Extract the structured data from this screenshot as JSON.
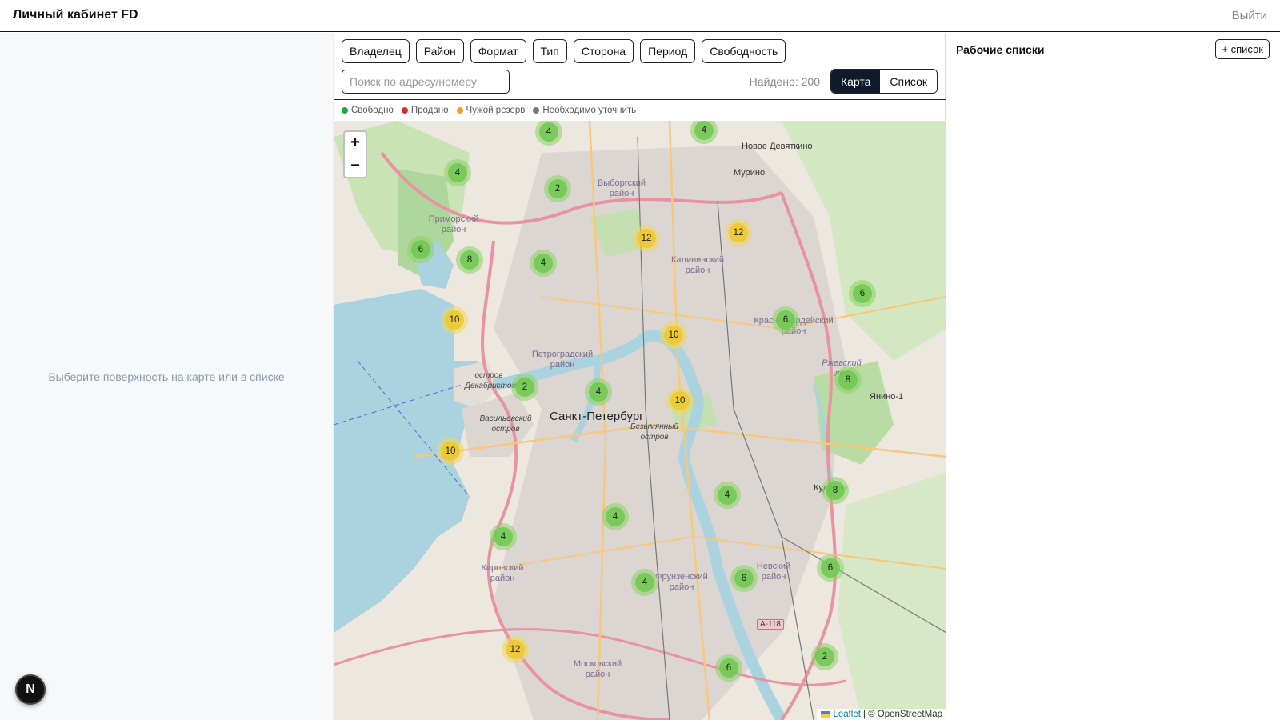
{
  "header": {
    "title": "Личный кабинет FD",
    "logout_label": "Выйти"
  },
  "left_panel": {
    "hint": "Выберите поверхность на карте или в списке",
    "badge": "N"
  },
  "filters": [
    "Владелец",
    "Район",
    "Формат",
    "Тип",
    "Сторона",
    "Период",
    "Свободность"
  ],
  "search": {
    "placeholder": "Поиск по адресу/номеру",
    "value": ""
  },
  "found_label": "Найдено: 200",
  "view_toggle": {
    "active": "Карта",
    "inactive": "Список"
  },
  "legend": [
    {
      "label": "Свободно",
      "color": "#22a34a"
    },
    {
      "label": "Продано",
      "color": "#d63031"
    },
    {
      "label": "Чужой резерв",
      "color": "#f0a020"
    },
    {
      "label": "Необходимо уточнить",
      "color": "#777777"
    }
  ],
  "map": {
    "zoom_in": "+",
    "zoom_out": "−",
    "attribution_link": "Leaflet",
    "attribution_text": "| © OpenStreetMap",
    "clusters": [
      "4",
      "4",
      "4",
      "2",
      "12",
      "12",
      "6",
      "8",
      "4",
      "6",
      "10",
      "6",
      "10",
      "8",
      "2",
      "4",
      "10",
      "10",
      "4",
      "8",
      "4",
      "4",
      "6",
      "4",
      "6",
      "12",
      "2",
      "6"
    ],
    "labels": {
      "novoe_devyatkino": "Новое Девяткино",
      "murino": "Мурино",
      "vyborgsky": "Выборгский район",
      "primorsky": "Приморский район",
      "kalininsky": "Калининский район",
      "krasnogvardeisky": "Красногвардейский район",
      "petrogradsky": "Петроградский район",
      "spb": "Санкт-Петербург",
      "dekabristov": "остров Декабристов",
      "vasilyevsky": "Васильевский остров",
      "bezymyanny": "Безымянный остров",
      "yanino": "Янино-1",
      "kirovsky": "Кировский район",
      "frunzensky": "Фрунзенский район",
      "nevsky": "Невский район",
      "moskovsky": "Московский район",
      "rzhevsky": "Ржевский лес",
      "kudrovo": "Кудрово",
      "a118": "А-118"
    }
  }
}
